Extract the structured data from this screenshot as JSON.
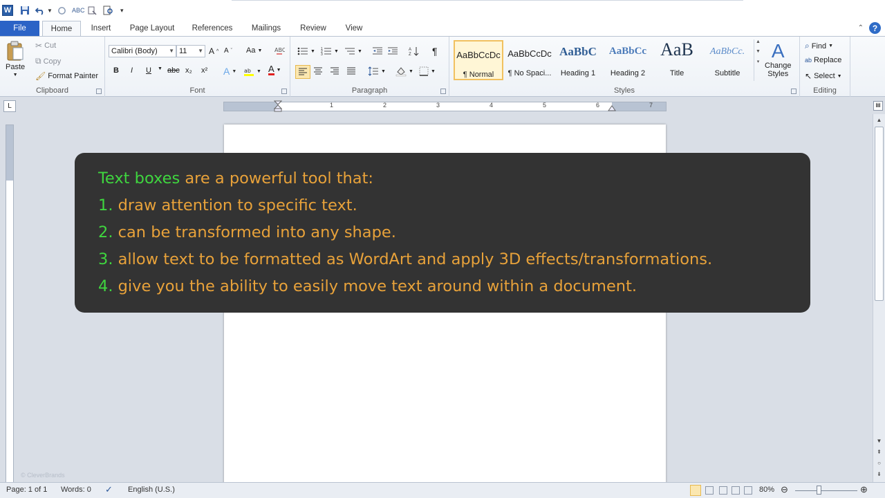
{
  "quick_access": {
    "app_icon_letter": "W"
  },
  "tabs": [
    {
      "label": "File"
    },
    {
      "label": "Home"
    },
    {
      "label": "Insert"
    },
    {
      "label": "Page Layout"
    },
    {
      "label": "References"
    },
    {
      "label": "Mailings"
    },
    {
      "label": "Review"
    },
    {
      "label": "View"
    }
  ],
  "help_label": "?",
  "clipboard": {
    "paste": "Paste",
    "cut": "Cut",
    "copy": "Copy",
    "format_painter": "Format Painter",
    "group_label": "Clipboard"
  },
  "font": {
    "family": "Calibri (Body)",
    "size": "11",
    "grow": "A",
    "shrink": "A",
    "change_case": "Aa",
    "bold": "B",
    "italic": "I",
    "underline": "U",
    "strike": "abc",
    "subscript": "x₂",
    "superscript": "x²",
    "font_color": "A",
    "group_label": "Font"
  },
  "paragraph": {
    "group_label": "Paragraph",
    "pilcrow": "¶"
  },
  "styles": {
    "items": [
      {
        "preview": "AaBbCcDc",
        "name": "¶ Normal"
      },
      {
        "preview": "AaBbCcDc",
        "name": "¶ No Spaci..."
      },
      {
        "preview": "AaBbC",
        "name": "Heading 1"
      },
      {
        "preview": "AaBbCc",
        "name": "Heading 2"
      },
      {
        "preview": "AaB",
        "name": "Title"
      },
      {
        "preview": "AaBbCc.",
        "name": "Subtitle"
      }
    ],
    "change_styles_line1": "Change",
    "change_styles_line2": "Styles",
    "group_label": "Styles"
  },
  "editing": {
    "find": "Find",
    "replace": "Replace",
    "select": "Select",
    "group_label": "Editing"
  },
  "ruler": {
    "numbers": [
      "1",
      "2",
      "3",
      "4",
      "5",
      "6",
      "7"
    ],
    "tab_selector": "L"
  },
  "callout": {
    "intro_highlight": "Text boxes",
    "intro_rest": " are a powerful tool that:",
    "items": [
      {
        "num": "1.",
        "text": " draw attention to specific text."
      },
      {
        "num": "2.",
        "text": " can be transformed into any shape."
      },
      {
        "num": "3.",
        "text": " allow text to be formatted as WordArt and apply 3D effects/transformations."
      },
      {
        "num": "4.",
        "text": " give you the ability to easily move text around within a document."
      }
    ]
  },
  "status": {
    "page": "Page: 1 of 1",
    "words": "Words: 0",
    "language": "English (U.S.)",
    "zoom": "80%"
  },
  "watermark": "© CleverBrands",
  "colors": {
    "accent_blue": "#2b63c6",
    "callout_bg": "#333333",
    "callout_orange": "#e8a23a",
    "callout_green": "#3fd63f"
  }
}
